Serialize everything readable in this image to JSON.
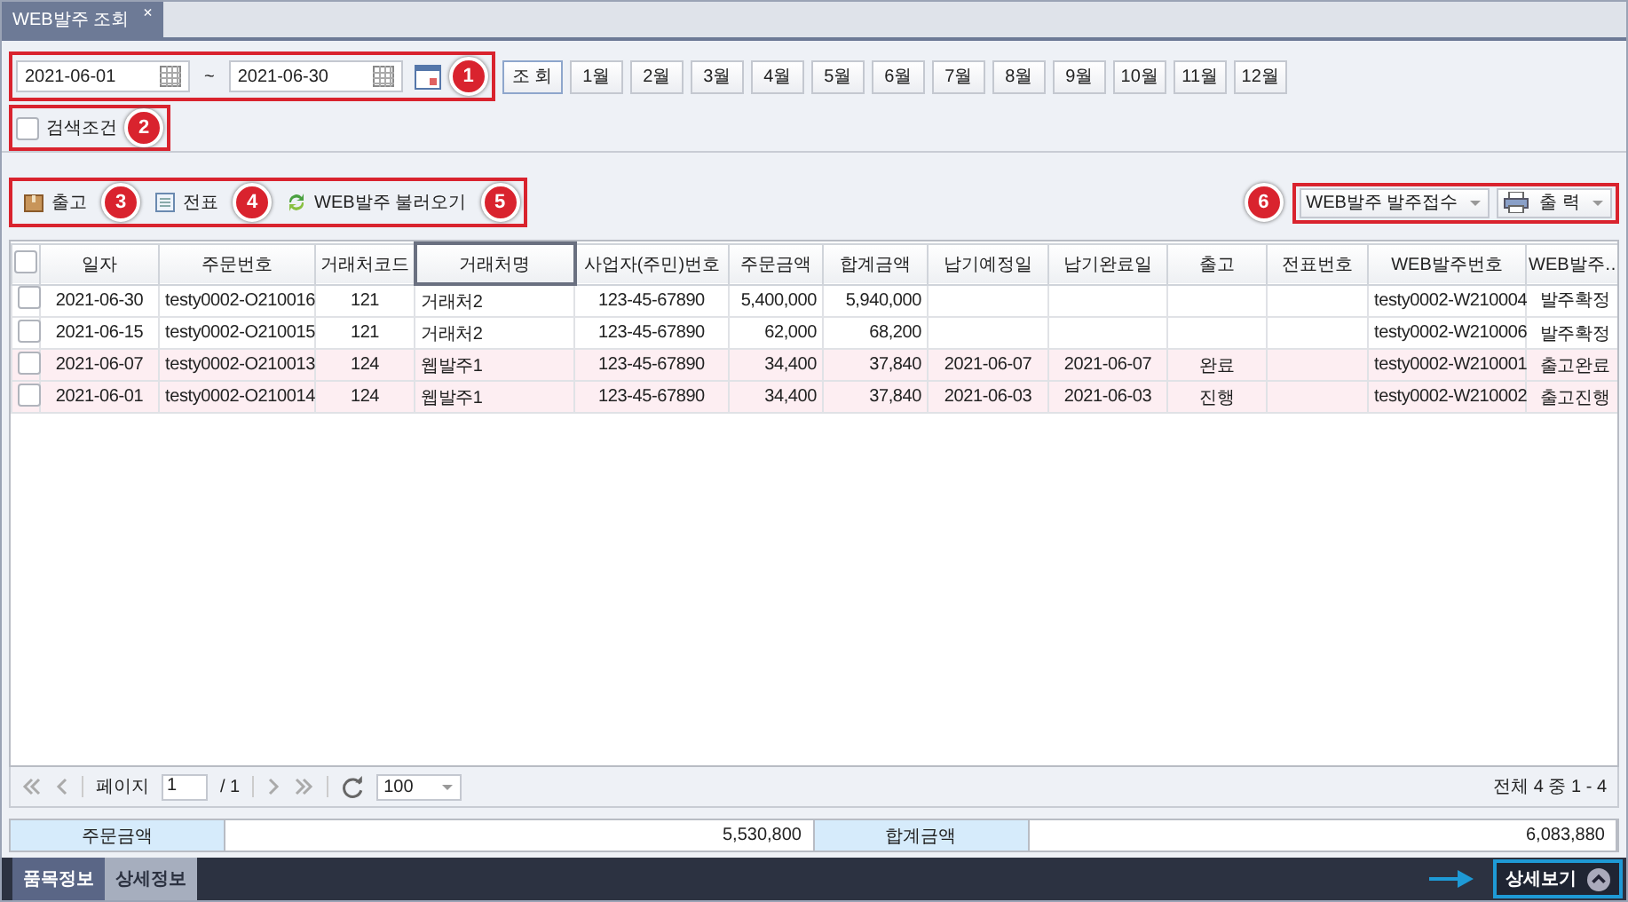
{
  "tab": {
    "label": "WEB발주 조회",
    "close": "×"
  },
  "search": {
    "callout": "1",
    "date_from": "2021-06-01",
    "separator": "~",
    "date_to": "2021-06-30",
    "search_button": "조 회",
    "months": [
      "1월",
      "2월",
      "3월",
      "4월",
      "5월",
      "6월",
      "7월",
      "8월",
      "9월",
      "10월",
      "11월",
      "12월"
    ],
    "condition": {
      "label": "검색조건",
      "checked": false,
      "callout": "2"
    }
  },
  "actions": [
    {
      "label": "출고",
      "callout": "3"
    },
    {
      "label": "전표",
      "callout": "4"
    },
    {
      "label": "WEB발주 불러오기",
      "callout": "5"
    }
  ],
  "right_actions": {
    "callout": "6",
    "receive_button": "WEB발주 발주접수",
    "print_button": "출 력"
  },
  "grid": {
    "all_checked": false,
    "columns": [
      {
        "label": "일자",
        "selected": false
      },
      {
        "label": "주문번호",
        "selected": false
      },
      {
        "label": "거래처코드",
        "selected": false
      },
      {
        "label": "거래처명",
        "selected": true
      },
      {
        "label": "사업자(주민)번호",
        "selected": false
      },
      {
        "label": "주문금액",
        "selected": false
      },
      {
        "label": "합계금액",
        "selected": false
      },
      {
        "label": "납기예정일",
        "selected": false
      },
      {
        "label": "납기완료일",
        "selected": false
      },
      {
        "label": "출고",
        "selected": false
      },
      {
        "label": "전표번호",
        "selected": false
      },
      {
        "label": "WEB발주번호",
        "selected": false
      },
      {
        "label": "WEB발주…",
        "selected": false
      }
    ],
    "rows": [
      {
        "checked": false,
        "highlighted": false,
        "cells": [
          "2021-06-30",
          "testy0002-O210016",
          "121",
          "거래처2",
          "123-45-67890",
          "5,400,000",
          "5,940,000",
          "",
          "",
          "",
          "",
          "testy0002-W210004",
          "발주확정"
        ]
      },
      {
        "checked": false,
        "highlighted": false,
        "cells": [
          "2021-06-15",
          "testy0002-O210015",
          "121",
          "거래처2",
          "123-45-67890",
          "62,000",
          "68,200",
          "",
          "",
          "",
          "",
          "testy0002-W210006",
          "발주확정"
        ]
      },
      {
        "checked": false,
        "highlighted": true,
        "cells": [
          "2021-06-07",
          "testy0002-O210013",
          "124",
          "웹발주1",
          "123-45-67890",
          "34,400",
          "37,840",
          "2021-06-07",
          "2021-06-07",
          "완료",
          "",
          "testy0002-W210001",
          "출고완료"
        ]
      },
      {
        "checked": false,
        "highlighted": true,
        "cells": [
          "2021-06-01",
          "testy0002-O210014",
          "124",
          "웹발주1",
          "123-45-67890",
          "34,400",
          "37,840",
          "2021-06-03",
          "2021-06-03",
          "진행",
          "",
          "testy0002-W210002",
          "출고진행"
        ]
      }
    ]
  },
  "pager": {
    "page_label": "페이지",
    "page": "1",
    "total_pages": "/ 1",
    "page_size": "100",
    "summary": "전체 4 중 1 - 4"
  },
  "totals": [
    {
      "label": "주문금액",
      "value": "5,530,800"
    },
    {
      "label": "합계금액",
      "value": "6,083,880"
    }
  ],
  "bottom": {
    "tabs": [
      {
        "label": "품목정보",
        "selected": true
      },
      {
        "label": "상세정보",
        "selected": false
      }
    ],
    "detail_button": "상세보기"
  }
}
